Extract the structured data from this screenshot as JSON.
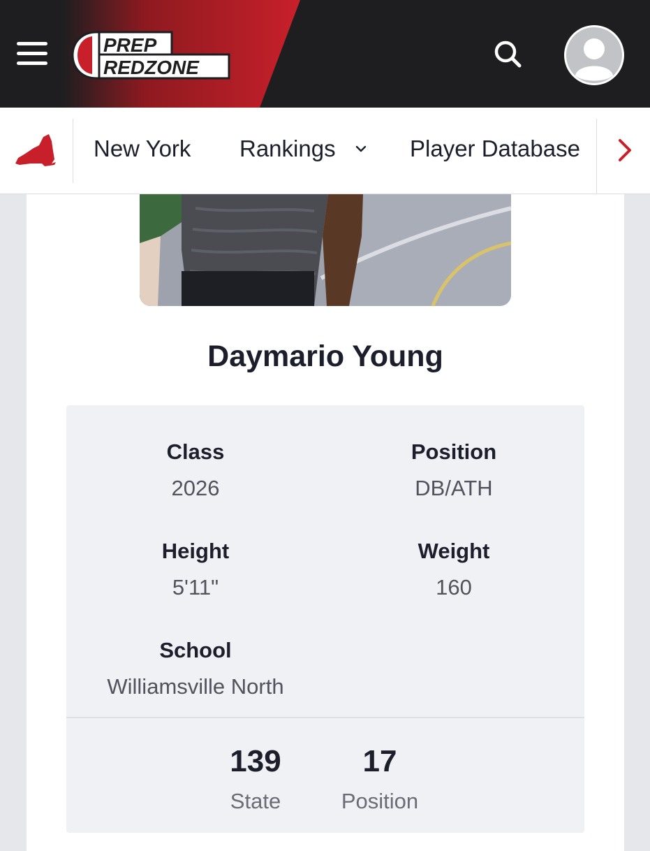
{
  "header": {
    "logo_line1": "PREP",
    "logo_line2": "REDZONE",
    "colors": {
      "bar": "#1e1e20",
      "accent": "#c8202a"
    },
    "icons": {
      "menu": "hamburger-menu-icon",
      "search": "search-icon",
      "avatar": "user-avatar-icon"
    }
  },
  "subnav": {
    "state_icon": "new-york-state-icon",
    "items": [
      {
        "label": "New York"
      },
      {
        "label": "Rankings"
      },
      {
        "label": "Player Database"
      }
    ],
    "next_icon": "chevron-right-icon"
  },
  "player": {
    "name": "Daymario Young",
    "fields": {
      "class_label": "Class",
      "class_value": "2026",
      "position_label": "Position",
      "position_value": "DB/ATH",
      "height_label": "Height",
      "height_value": "5'11\"",
      "weight_label": "Weight",
      "weight_value": "160",
      "school_label": "School",
      "school_value": "Williamsville North"
    },
    "rankings": [
      {
        "value": "139",
        "label": "State"
      },
      {
        "value": "17",
        "label": "Position"
      }
    ]
  }
}
